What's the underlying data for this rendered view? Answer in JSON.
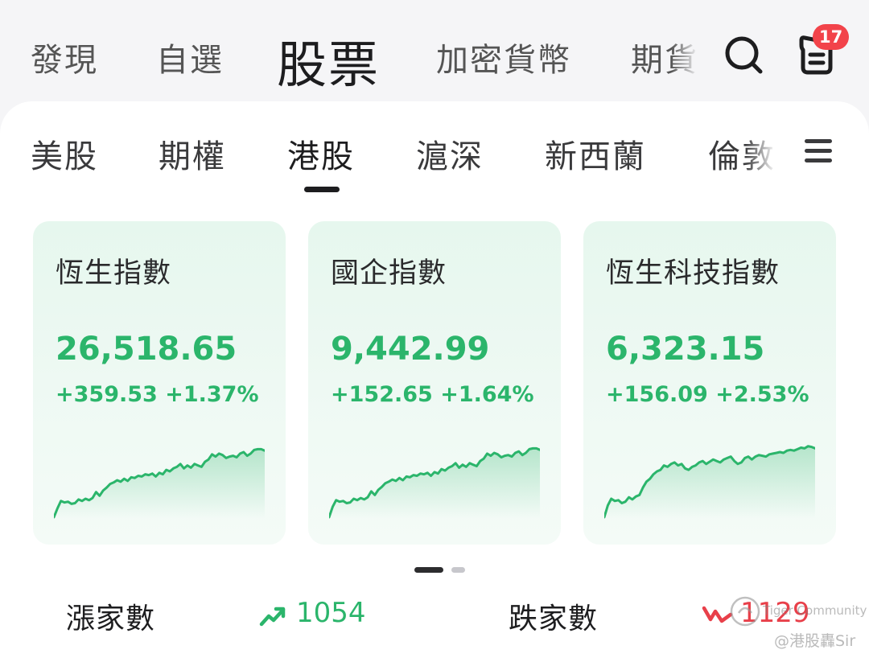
{
  "top_tabs": [
    {
      "label": "發現"
    },
    {
      "label": "自選"
    },
    {
      "label": "股票"
    },
    {
      "label": "加密貨幣"
    },
    {
      "label": "期貨"
    }
  ],
  "notifications": {
    "count": "17"
  },
  "market_tabs": [
    {
      "label": "美股"
    },
    {
      "label": "期權"
    },
    {
      "label": "港股"
    },
    {
      "label": "滬深"
    },
    {
      "label": "新西蘭"
    },
    {
      "label": "倫敦"
    }
  ],
  "indices": [
    {
      "name": "恆生指數",
      "price": "26,518.65",
      "change": "+359.53 +1.37%",
      "sparkline": [
        0.0,
        0.12,
        0.22,
        0.2,
        0.21,
        0.18,
        0.19,
        0.24,
        0.22,
        0.25,
        0.23,
        0.26,
        0.34,
        0.29,
        0.36,
        0.4,
        0.45,
        0.47,
        0.5,
        0.48,
        0.52,
        0.49,
        0.54,
        0.53,
        0.56,
        0.55,
        0.58,
        0.57,
        0.59,
        0.55,
        0.6,
        0.58,
        0.64,
        0.62,
        0.66,
        0.68,
        0.72,
        0.66,
        0.7,
        0.67,
        0.72,
        0.7,
        0.68,
        0.75,
        0.78,
        0.85,
        0.82,
        0.86,
        0.84,
        0.8,
        0.82,
        0.83,
        0.81,
        0.86,
        0.88,
        0.83,
        0.86,
        0.91,
        0.92,
        0.92,
        0.9
      ]
    },
    {
      "name": "國企指數",
      "price": "9,442.99",
      "change": "+152.65 +1.64%",
      "sparkline": [
        0.0,
        0.14,
        0.23,
        0.21,
        0.22,
        0.19,
        0.2,
        0.25,
        0.23,
        0.26,
        0.24,
        0.27,
        0.35,
        0.3,
        0.37,
        0.41,
        0.46,
        0.48,
        0.51,
        0.49,
        0.53,
        0.5,
        0.55,
        0.54,
        0.57,
        0.56,
        0.59,
        0.58,
        0.6,
        0.56,
        0.61,
        0.59,
        0.65,
        0.63,
        0.67,
        0.69,
        0.73,
        0.67,
        0.71,
        0.68,
        0.73,
        0.71,
        0.69,
        0.76,
        0.79,
        0.86,
        0.83,
        0.87,
        0.85,
        0.81,
        0.83,
        0.84,
        0.82,
        0.87,
        0.89,
        0.84,
        0.87,
        0.92,
        0.93,
        0.93,
        0.91
      ]
    },
    {
      "name": "恆生科技指數",
      "price": "6,323.15",
      "change": "+156.09 +2.53%",
      "sparkline": [
        0.0,
        0.16,
        0.25,
        0.22,
        0.23,
        0.19,
        0.21,
        0.27,
        0.24,
        0.28,
        0.3,
        0.4,
        0.48,
        0.52,
        0.58,
        0.62,
        0.64,
        0.7,
        0.68,
        0.72,
        0.74,
        0.7,
        0.72,
        0.66,
        0.64,
        0.68,
        0.7,
        0.74,
        0.76,
        0.72,
        0.75,
        0.78,
        0.76,
        0.74,
        0.78,
        0.8,
        0.82,
        0.76,
        0.72,
        0.74,
        0.8,
        0.82,
        0.78,
        0.82,
        0.84,
        0.83,
        0.82,
        0.85,
        0.86,
        0.87,
        0.88,
        0.87,
        0.9,
        0.91,
        0.9,
        0.92,
        0.94,
        0.93,
        0.96,
        0.95,
        0.93
      ]
    }
  ],
  "breadth": {
    "up_label": "漲家數",
    "up_count": "1054",
    "down_label": "跌家數",
    "down_count": "1129"
  },
  "colors": {
    "up": "#2bb56b",
    "down": "#e8404a",
    "badge": "#f2434a"
  },
  "icons": {
    "search": "search-icon",
    "notifications": "notification-icon",
    "menu": "menu-icon",
    "up_trend": "trend-up-icon",
    "down_trend": "trend-down-icon"
  },
  "watermark": {
    "brand": "Tiger Community",
    "author": "@港股轟Sir"
  }
}
